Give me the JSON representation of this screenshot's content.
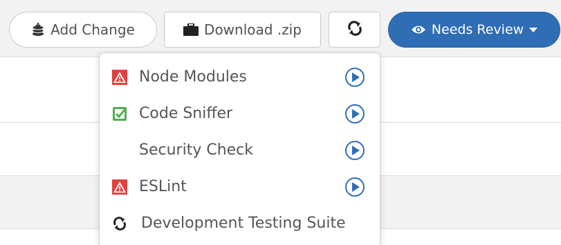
{
  "toolbar": {
    "add_change": {
      "label": "Add Change",
      "icon": "coins-stack-icon"
    },
    "download": {
      "label": "Download .zip",
      "icon": "briefcase-icon"
    },
    "refresh": {
      "icon": "refresh-icon"
    },
    "review": {
      "label": "Needs Review",
      "icon": "eye-icon",
      "color": "#2f6db5"
    }
  },
  "dropdown": {
    "items": [
      {
        "label": "Node Modules",
        "status": "warning",
        "status_icon": "warning-icon",
        "action_icon": "play-circle-icon"
      },
      {
        "label": "Code Sniffer",
        "status": "passed",
        "status_icon": "check-icon",
        "action_icon": "play-circle-icon"
      },
      {
        "label": "Security Check",
        "status": "none",
        "status_icon": "",
        "action_icon": "play-circle-icon"
      },
      {
        "label": "ESLint",
        "status": "warning",
        "status_icon": "warning-icon",
        "action_icon": "play-circle-icon"
      },
      {
        "label": "Development Testing Suite",
        "status": "running",
        "status_icon": "refresh-icon"
      }
    ]
  },
  "colors": {
    "warning": "#e0413f",
    "passed": "#4caf50",
    "action": "#2f6db5",
    "toolbar_bg": "#f2f2f2"
  }
}
